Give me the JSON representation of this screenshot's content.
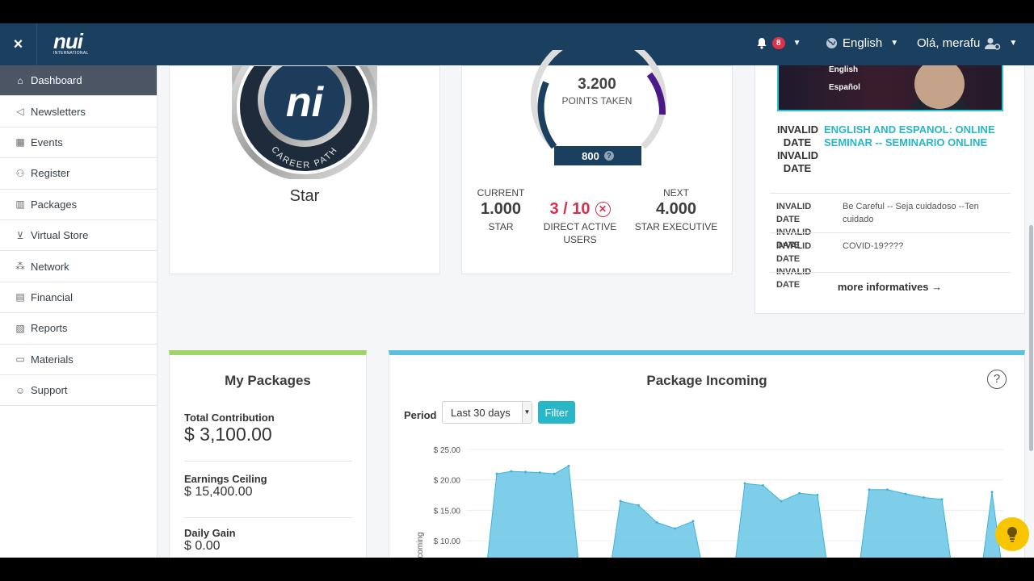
{
  "topbar": {
    "close": "×",
    "logo_main": "nui",
    "logo_sub": "INTERNATIONAL",
    "notifications_count": "8",
    "language": "English",
    "greeting": "Olá, merafu"
  },
  "sidebar": {
    "items": [
      {
        "label": "Dashboard",
        "icon": "home-icon",
        "active": true
      },
      {
        "label": "Newsletters",
        "icon": "megaphone-icon"
      },
      {
        "label": "Events",
        "icon": "calendar-icon"
      },
      {
        "label": "Register",
        "icon": "user-plus-icon"
      },
      {
        "label": "Packages",
        "icon": "chart-icon"
      },
      {
        "label": "Virtual Store",
        "icon": "cart-icon"
      },
      {
        "label": "Network",
        "icon": "network-icon"
      },
      {
        "label": "Financial",
        "icon": "receipt-icon"
      },
      {
        "label": "Reports",
        "icon": "report-icon"
      },
      {
        "label": "Materials",
        "icon": "folder-icon"
      },
      {
        "label": "Support",
        "icon": "support-icon"
      }
    ]
  },
  "career": {
    "medal_text": "CAREER PATH",
    "rank": "Star"
  },
  "points": {
    "value": "3.200",
    "label": "POINTS TAKEN",
    "target": "800",
    "current_label": "CURRENT",
    "current_value": "1.000",
    "current_rank": "STAR",
    "direct_value": "3 / 10",
    "direct_label": "DIRECT ACTIVE USERS",
    "next_label": "NEXT",
    "next_value": "4.000",
    "next_rank": "STAR EXECUTIVE"
  },
  "news": {
    "banner_line1": "English",
    "banner_line2": "Español",
    "main_dates": "INVALID DATE INVALID DATE",
    "main_title": "ENGLISH AND ESPANOL: ONLINE SEMINAR -- SEMINARIO ONLINE",
    "items": [
      {
        "dates": "INVALID DATE INVALID DATE",
        "text": "Be Careful -- Seja cuidadoso --Ten cuidado"
      },
      {
        "dates": "INVALID DATE INVALID DATE",
        "text": "COVID-19????"
      }
    ],
    "more": "more informatives →"
  },
  "packages": {
    "title": "My Packages",
    "total_label": "Total Contribution",
    "total_value": "$ 3,100.00",
    "ceiling_label": "Earnings Ceiling",
    "ceiling_value": "$ 15,400.00",
    "daily_label": "Daily Gain",
    "daily_value": "$ 0.00"
  },
  "incoming": {
    "title": "Package Incoming",
    "period_label": "Period",
    "period_value": "Last 30 days",
    "filter_label": "Filter"
  },
  "chart_data": {
    "type": "area",
    "ylabel": "Incoming",
    "yticks": [
      "$ 25.00",
      "$ 20.00",
      "$ 15.00",
      "$ 10.00"
    ],
    "ylim": [
      6,
      25
    ],
    "color": "#67c6e6",
    "segments": [
      [
        21.0,
        21.4,
        21.3,
        21.2,
        21.0,
        22.3
      ],
      [
        16.5,
        15.8,
        13.0,
        12.0,
        13.2
      ],
      [
        19.4,
        19.1,
        16.5,
        17.8,
        17.5
      ],
      [
        18.4,
        18.4,
        17.7,
        17.1,
        16.8
      ],
      [
        18.0
      ]
    ]
  },
  "colors": {
    "topbar": "#1b3f5e",
    "accent_teal": "#29b6c6",
    "accent_red": "#d3314b",
    "packages_border": "#a0d468",
    "incoming_border": "#5bc0de"
  }
}
